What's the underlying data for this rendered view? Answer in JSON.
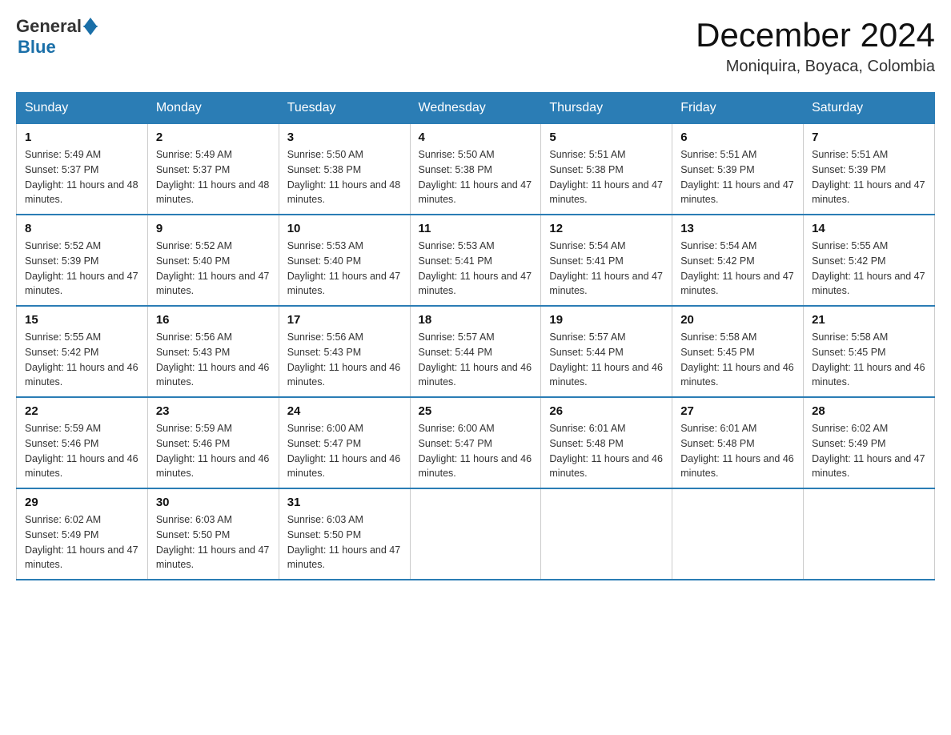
{
  "header": {
    "logo_general": "General",
    "logo_blue": "Blue",
    "month_year": "December 2024",
    "location": "Moniquira, Boyaca, Colombia"
  },
  "days_of_week": [
    "Sunday",
    "Monday",
    "Tuesday",
    "Wednesday",
    "Thursday",
    "Friday",
    "Saturday"
  ],
  "weeks": [
    [
      {
        "day": "1",
        "sunrise": "5:49 AM",
        "sunset": "5:37 PM",
        "daylight": "11 hours and 48 minutes."
      },
      {
        "day": "2",
        "sunrise": "5:49 AM",
        "sunset": "5:37 PM",
        "daylight": "11 hours and 48 minutes."
      },
      {
        "day": "3",
        "sunrise": "5:50 AM",
        "sunset": "5:38 PM",
        "daylight": "11 hours and 48 minutes."
      },
      {
        "day": "4",
        "sunrise": "5:50 AM",
        "sunset": "5:38 PM",
        "daylight": "11 hours and 47 minutes."
      },
      {
        "day": "5",
        "sunrise": "5:51 AM",
        "sunset": "5:38 PM",
        "daylight": "11 hours and 47 minutes."
      },
      {
        "day": "6",
        "sunrise": "5:51 AM",
        "sunset": "5:39 PM",
        "daylight": "11 hours and 47 minutes."
      },
      {
        "day": "7",
        "sunrise": "5:51 AM",
        "sunset": "5:39 PM",
        "daylight": "11 hours and 47 minutes."
      }
    ],
    [
      {
        "day": "8",
        "sunrise": "5:52 AM",
        "sunset": "5:39 PM",
        "daylight": "11 hours and 47 minutes."
      },
      {
        "day": "9",
        "sunrise": "5:52 AM",
        "sunset": "5:40 PM",
        "daylight": "11 hours and 47 minutes."
      },
      {
        "day": "10",
        "sunrise": "5:53 AM",
        "sunset": "5:40 PM",
        "daylight": "11 hours and 47 minutes."
      },
      {
        "day": "11",
        "sunrise": "5:53 AM",
        "sunset": "5:41 PM",
        "daylight": "11 hours and 47 minutes."
      },
      {
        "day": "12",
        "sunrise": "5:54 AM",
        "sunset": "5:41 PM",
        "daylight": "11 hours and 47 minutes."
      },
      {
        "day": "13",
        "sunrise": "5:54 AM",
        "sunset": "5:42 PM",
        "daylight": "11 hours and 47 minutes."
      },
      {
        "day": "14",
        "sunrise": "5:55 AM",
        "sunset": "5:42 PM",
        "daylight": "11 hours and 47 minutes."
      }
    ],
    [
      {
        "day": "15",
        "sunrise": "5:55 AM",
        "sunset": "5:42 PM",
        "daylight": "11 hours and 46 minutes."
      },
      {
        "day": "16",
        "sunrise": "5:56 AM",
        "sunset": "5:43 PM",
        "daylight": "11 hours and 46 minutes."
      },
      {
        "day": "17",
        "sunrise": "5:56 AM",
        "sunset": "5:43 PM",
        "daylight": "11 hours and 46 minutes."
      },
      {
        "day": "18",
        "sunrise": "5:57 AM",
        "sunset": "5:44 PM",
        "daylight": "11 hours and 46 minutes."
      },
      {
        "day": "19",
        "sunrise": "5:57 AM",
        "sunset": "5:44 PM",
        "daylight": "11 hours and 46 minutes."
      },
      {
        "day": "20",
        "sunrise": "5:58 AM",
        "sunset": "5:45 PM",
        "daylight": "11 hours and 46 minutes."
      },
      {
        "day": "21",
        "sunrise": "5:58 AM",
        "sunset": "5:45 PM",
        "daylight": "11 hours and 46 minutes."
      }
    ],
    [
      {
        "day": "22",
        "sunrise": "5:59 AM",
        "sunset": "5:46 PM",
        "daylight": "11 hours and 46 minutes."
      },
      {
        "day": "23",
        "sunrise": "5:59 AM",
        "sunset": "5:46 PM",
        "daylight": "11 hours and 46 minutes."
      },
      {
        "day": "24",
        "sunrise": "6:00 AM",
        "sunset": "5:47 PM",
        "daylight": "11 hours and 46 minutes."
      },
      {
        "day": "25",
        "sunrise": "6:00 AM",
        "sunset": "5:47 PM",
        "daylight": "11 hours and 46 minutes."
      },
      {
        "day": "26",
        "sunrise": "6:01 AM",
        "sunset": "5:48 PM",
        "daylight": "11 hours and 46 minutes."
      },
      {
        "day": "27",
        "sunrise": "6:01 AM",
        "sunset": "5:48 PM",
        "daylight": "11 hours and 46 minutes."
      },
      {
        "day": "28",
        "sunrise": "6:02 AM",
        "sunset": "5:49 PM",
        "daylight": "11 hours and 47 minutes."
      }
    ],
    [
      {
        "day": "29",
        "sunrise": "6:02 AM",
        "sunset": "5:49 PM",
        "daylight": "11 hours and 47 minutes."
      },
      {
        "day": "30",
        "sunrise": "6:03 AM",
        "sunset": "5:50 PM",
        "daylight": "11 hours and 47 minutes."
      },
      {
        "day": "31",
        "sunrise": "6:03 AM",
        "sunset": "5:50 PM",
        "daylight": "11 hours and 47 minutes."
      },
      null,
      null,
      null,
      null
    ]
  ]
}
